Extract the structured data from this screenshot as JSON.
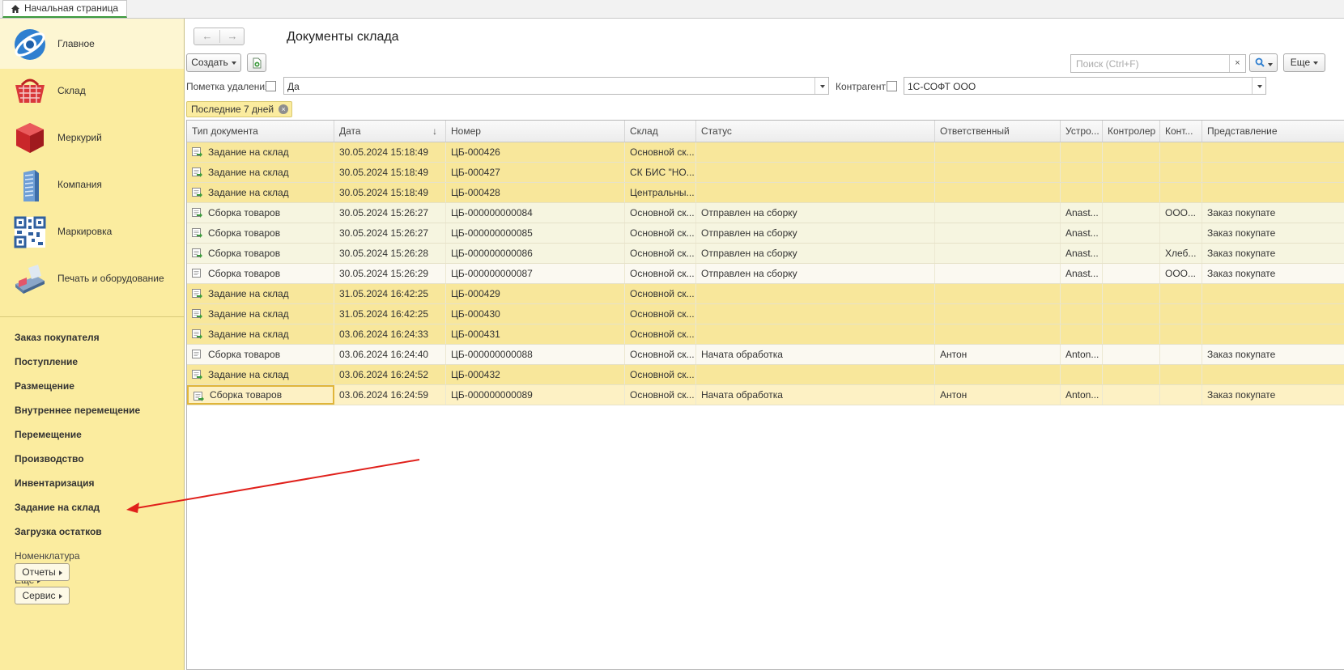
{
  "top_tab": {
    "label": "Начальная страница"
  },
  "sidebar": {
    "sections": [
      {
        "label": "Главное",
        "icon": "logo-ring-icon",
        "active": true
      },
      {
        "label": "Склад",
        "icon": "basket-icon"
      },
      {
        "label": "Меркурий",
        "icon": "red-cube-icon"
      },
      {
        "label": "Компания",
        "icon": "building-icon"
      },
      {
        "label": "Маркировка",
        "icon": "qr-code-icon"
      },
      {
        "label": "Печать и оборудование",
        "icon": "cash-register-icon"
      }
    ],
    "nav": [
      {
        "label": "Заказ покупателя",
        "bold": true
      },
      {
        "label": "Поступление",
        "bold": true
      },
      {
        "label": "Размещение",
        "bold": true
      },
      {
        "label": "Внутреннее перемещение",
        "bold": true
      },
      {
        "label": "Перемещение",
        "bold": true
      },
      {
        "label": "Производство",
        "bold": true
      },
      {
        "label": "Инвентаризация",
        "bold": true
      },
      {
        "label": "Задание на склад",
        "bold": true
      },
      {
        "label": "Загрузка остатков",
        "bold": true
      },
      {
        "label": "Номенклатура",
        "bold": false
      },
      {
        "label": "Еще",
        "bold": false
      }
    ],
    "reports_btn": "Отчеты",
    "service_btn": "Сервис"
  },
  "toolbar": {
    "title": "Документы склада",
    "create_label": "Создать",
    "search_placeholder": "Поиск (Ctrl+F)",
    "search_clear": "×",
    "more_label": "Еще"
  },
  "filters": {
    "deletion_label": "Пометка удаления:",
    "deletion_value": "Да",
    "counterparty_label": "Контрагент:",
    "counterparty_value": "1С-СОФТ ООО",
    "chip_label": "Последние 7 дней"
  },
  "table": {
    "columns": [
      "Тип документа",
      "Дата",
      "Номер",
      "Склад",
      "Статус",
      "Ответственный",
      "Устро...",
      "Контролер",
      "Конт...",
      "Представление"
    ],
    "sort_marker": "↓",
    "rows": [
      {
        "kind": "task",
        "cells": [
          "Задание на склад",
          "30.05.2024 15:18:49",
          "ЦБ-000426",
          "Основной ск...",
          "",
          "",
          "",
          "",
          "",
          ""
        ]
      },
      {
        "kind": "task",
        "cells": [
          "Задание на склад",
          "30.05.2024 15:18:49",
          "ЦБ-000427",
          "СК БИС \"НО...",
          "",
          "",
          "",
          "",
          "",
          ""
        ]
      },
      {
        "kind": "task",
        "cells": [
          "Задание на склад",
          "30.05.2024 15:18:49",
          "ЦБ-000428",
          "Центральны...",
          "",
          "",
          "",
          "",
          "",
          ""
        ]
      },
      {
        "kind": "asm",
        "cells": [
          "Сборка товаров",
          "30.05.2024 15:26:27",
          "ЦБ-000000000084",
          "Основной ск...",
          "Отправлен на сборку",
          "",
          "Anast...",
          "",
          "ООО...",
          "Заказ покупате"
        ]
      },
      {
        "kind": "asm",
        "cells": [
          "Сборка товаров",
          "30.05.2024 15:26:27",
          "ЦБ-000000000085",
          "Основной ск...",
          "Отправлен на сборку",
          "",
          "Anast...",
          "",
          "",
          "Заказ покупате"
        ]
      },
      {
        "kind": "asm",
        "cells": [
          "Сборка товаров",
          "30.05.2024 15:26:28",
          "ЦБ-000000000086",
          "Основной ск...",
          "Отправлен на сборку",
          "",
          "Anast...",
          "",
          "Хлеб...",
          "Заказ покупате"
        ]
      },
      {
        "kind": "asm-plain",
        "cells": [
          "Сборка товаров",
          "30.05.2024 15:26:29",
          "ЦБ-000000000087",
          "Основной ск...",
          "Отправлен на сборку",
          "",
          "Anast...",
          "",
          "ООО...",
          "Заказ покупате"
        ]
      },
      {
        "kind": "task",
        "cells": [
          "Задание на склад",
          "31.05.2024 16:42:25",
          "ЦБ-000429",
          "Основной ск...",
          "",
          "",
          "",
          "",
          "",
          ""
        ]
      },
      {
        "kind": "task",
        "cells": [
          "Задание на склад",
          "31.05.2024 16:42:25",
          "ЦБ-000430",
          "Основной ск...",
          "",
          "",
          "",
          "",
          "",
          ""
        ]
      },
      {
        "kind": "task",
        "cells": [
          "Задание на склад",
          "03.06.2024 16:24:33",
          "ЦБ-000431",
          "Основной ск...",
          "",
          "",
          "",
          "",
          "",
          ""
        ]
      },
      {
        "kind": "plain",
        "cells": [
          "Сборка товаров",
          "03.06.2024 16:24:40",
          "ЦБ-000000000088",
          "Основной ск...",
          "Начата обработка",
          "Антон",
          "Anton...",
          "",
          "",
          "Заказ покупате"
        ]
      },
      {
        "kind": "task",
        "cells": [
          "Задание на склад",
          "03.06.2024 16:24:52",
          "ЦБ-000432",
          "Основной ск...",
          "",
          "",
          "",
          "",
          "",
          ""
        ]
      },
      {
        "kind": "sel",
        "cells": [
          "Сборка товаров",
          "03.06.2024 16:24:59",
          "ЦБ-000000000089",
          "Основной ск...",
          "Начата обработка",
          "Антон",
          "Anton...",
          "",
          "",
          "Заказ покупате"
        ]
      }
    ]
  },
  "colors": {
    "sidebar_bg": "#fbec9f",
    "task_row": "#f8e79b",
    "selected_row": "#fdf1c4",
    "annotation_arrow": "#e0201b"
  }
}
